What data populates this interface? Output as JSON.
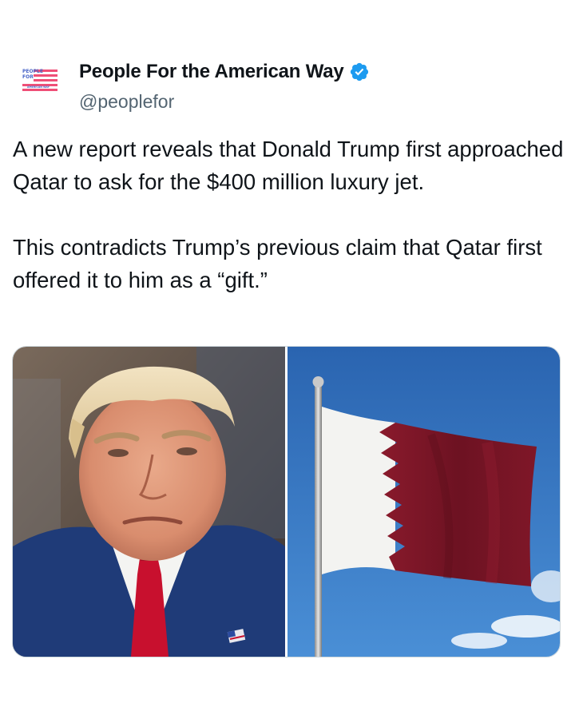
{
  "account": {
    "display_name": "People For the American Way",
    "handle": "@peoplefor",
    "avatar_text": [
      "PEOPLE",
      "FOR",
      "AMERICAN WAY"
    ],
    "verified_icon": "verified-badge-icon",
    "verified_color": "#1d9bf0"
  },
  "tweet": {
    "paragraphs": [
      "A new report reveals that Donald Trump first approached Qatar to ask for the $400 million luxury jet.",
      "This contradicts Trump’s previous claim that Qatar first offered it to him as a “gift.”"
    ]
  },
  "media": {
    "images": [
      "portrait-photo",
      "qatar-flag-photo"
    ]
  },
  "colors": {
    "text": "#0f1419",
    "secondary": "#536471",
    "flag_maroon": "#7a1526",
    "sky": "#2e6fb8"
  }
}
